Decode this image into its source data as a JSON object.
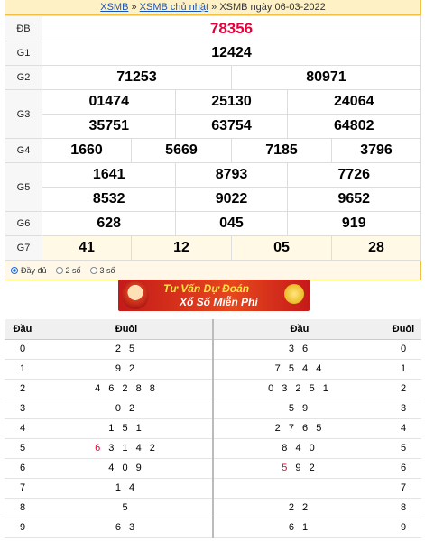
{
  "breadcrumb": {
    "link1": "XSMB",
    "sep1": " » ",
    "link2": "XSMB chủ nhật",
    "sep2": " » ",
    "current": "XSMB ngày 06-03-2022"
  },
  "results": {
    "db_label": "ĐB",
    "db": "78356",
    "g1_label": "G1",
    "g1": "12424",
    "g2_label": "G2",
    "g2": [
      "71253",
      "80971"
    ],
    "g3_label": "G3",
    "g3": [
      "01474",
      "25130",
      "24064",
      "35751",
      "63754",
      "64802"
    ],
    "g4_label": "G4",
    "g4": [
      "1660",
      "5669",
      "7185",
      "3796"
    ],
    "g5_label": "G5",
    "g5": [
      "1641",
      "8793",
      "7726",
      "8532",
      "9022",
      "9652"
    ],
    "g6_label": "G6",
    "g6": [
      "628",
      "045",
      "919"
    ],
    "g7_label": "G7",
    "g7": [
      "41",
      "12",
      "05",
      "28"
    ]
  },
  "options": {
    "full": "Đầy đủ",
    "two": "2 số",
    "three": "3 số"
  },
  "banner": {
    "line1": "Tư Vấn Dự Đoán",
    "line2": "Xổ Số Miễn Phí"
  },
  "loto": {
    "headers": [
      "Đầu",
      "Đuôi",
      "Đầu",
      "Đuôi"
    ],
    "rows": [
      {
        "d": "0",
        "duoi": "2 5",
        "dau": "3 6",
        "e": "0"
      },
      {
        "d": "1",
        "duoi": "9 2",
        "dau": "7 5 4 4",
        "e": "1"
      },
      {
        "d": "2",
        "duoi": "4 6 2 8 8",
        "dau": "0 3 2 5 1",
        "e": "2"
      },
      {
        "d": "3",
        "duoi": "0 2",
        "dau": "5 9",
        "e": "3"
      },
      {
        "d": "4",
        "duoi": "1 5 1",
        "dau": "2 7 6 5",
        "e": "4"
      },
      {
        "d": "5",
        "duoi_hl": "6",
        "duoi": " 3 1 4 2",
        "dau": "8 4 0",
        "e": "5"
      },
      {
        "d": "6",
        "duoi": "4 0 9",
        "dau_hl": "5",
        "dau": " 9 2",
        "e": "6"
      },
      {
        "d": "7",
        "duoi": "1 4",
        "dau": "",
        "e": "7"
      },
      {
        "d": "8",
        "duoi": "5",
        "dau": "2 2",
        "e": "8"
      },
      {
        "d": "9",
        "duoi": "6 3",
        "dau": "6 1",
        "e": "9"
      }
    ]
  },
  "colors": {
    "special": "#e4003a",
    "link": "#1a55b5",
    "accent": "#f0c040"
  }
}
